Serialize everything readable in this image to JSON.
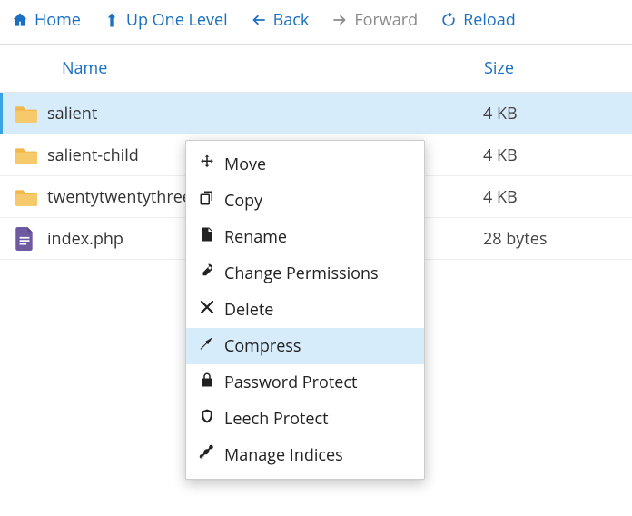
{
  "toolbar": {
    "home": "Home",
    "up": "Up One Level",
    "back": "Back",
    "forward": "Forward",
    "reload": "Reload"
  },
  "columns": {
    "name": "Name",
    "size": "Size"
  },
  "rows": [
    {
      "name": "salient",
      "size": "4 KB",
      "type": "folder",
      "selected": true
    },
    {
      "name": "salient-child",
      "size": "4 KB",
      "type": "folder",
      "selected": false
    },
    {
      "name": "twentytwentythree",
      "size": "4 KB",
      "type": "folder",
      "selected": false
    },
    {
      "name": "index.php",
      "size": "28 bytes",
      "type": "file",
      "selected": false
    }
  ],
  "context_menu": {
    "items": [
      {
        "id": "move",
        "label": "Move",
        "highlight": false
      },
      {
        "id": "copy",
        "label": "Copy",
        "highlight": false
      },
      {
        "id": "rename",
        "label": "Rename",
        "highlight": false
      },
      {
        "id": "permissions",
        "label": "Change Permissions",
        "highlight": false
      },
      {
        "id": "delete",
        "label": "Delete",
        "highlight": false
      },
      {
        "id": "compress",
        "label": "Compress",
        "highlight": true
      },
      {
        "id": "password",
        "label": "Password Protect",
        "highlight": false
      },
      {
        "id": "leech",
        "label": "Leech Protect",
        "highlight": false
      },
      {
        "id": "indices",
        "label": "Manage Indices",
        "highlight": false
      }
    ]
  }
}
